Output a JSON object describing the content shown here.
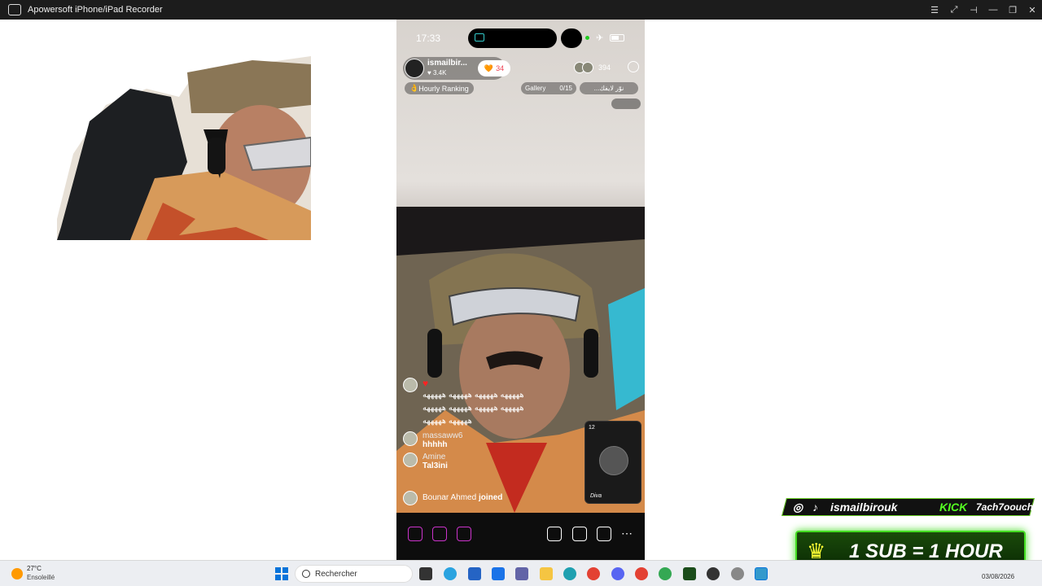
{
  "window": {
    "title": "Apowersoft iPhone/iPad Recorder"
  },
  "phone": {
    "time": "17:33",
    "host": {
      "name": "ismailbir...",
      "likes": "3.4K",
      "follow_count": "34"
    },
    "viewer_count": "394",
    "hourly_ranking": "Hourly Ranking",
    "gallery_label": "Gallery",
    "gallery_count": "0/15",
    "arabic_pill": "...نوّر لايفك",
    "comments": [
      {
        "user": "massaww6",
        "text": "hhhhh"
      },
      {
        "user": "Amine",
        "text": "Tal3ini"
      }
    ],
    "laugh_text_1": "هههههه هههههه هههههه هههههه",
    "laugh_text_2": "هههههه هههههه هههههه هههههه",
    "laugh_text_3": "هههههه هههههه",
    "joined_user": "Bounar Ahmed",
    "joined_label": "joined",
    "mini_count": "12",
    "mini_caption": "Diva"
  },
  "overlay": {
    "handle": "ismailbirouk",
    "kick_label": "KICK",
    "kick_handle": "7ach7oouch",
    "sub_text": "1 SUB = 1 HOUR"
  },
  "taskbar": {
    "weather_temp": "27°C",
    "weather_desc": "Ensoleillé",
    "search_placeholder": "Rechercher",
    "date": "03/08/2026"
  },
  "colors": {
    "accent_green": "#44dd22",
    "tiktok_pink": "#ff3355"
  }
}
